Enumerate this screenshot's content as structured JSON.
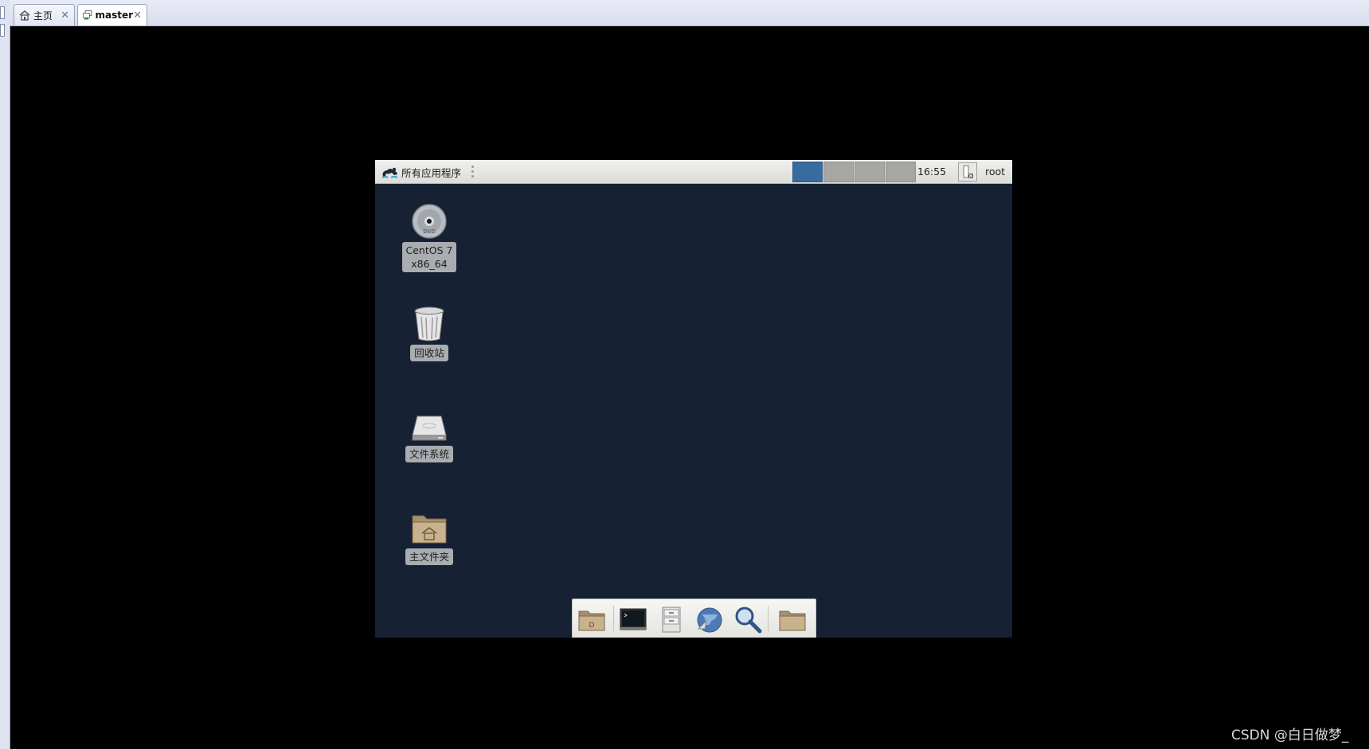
{
  "host": {
    "tabs": [
      {
        "label": "主页",
        "close": "✕",
        "active": false
      },
      {
        "label": "master",
        "close": "✕",
        "active": true
      }
    ]
  },
  "guest": {
    "panel": {
      "apps_label": "所有应用程序",
      "workspaces": 4,
      "active_workspace": 1,
      "clock": "16:55",
      "user": "root"
    },
    "desktop_icons": [
      {
        "label": "CentOS 7\nx86_64",
        "icon": "dvd-icon",
        "disc_text": "DVD"
      },
      {
        "label": "回收站",
        "icon": "trash-icon"
      },
      {
        "label": "文件系统",
        "icon": "drive-icon"
      },
      {
        "label": "主文件夹",
        "icon": "home-folder-icon"
      }
    ],
    "dock_items": [
      "file-manager-icon",
      "terminal-icon",
      "file-cabinet-icon",
      "web-browser-icon",
      "search-icon",
      "folder-icon"
    ],
    "colors": {
      "desktop": "#162133",
      "active_workspace": "#3a6b9f"
    }
  },
  "watermark": "CSDN @白日做梦_"
}
